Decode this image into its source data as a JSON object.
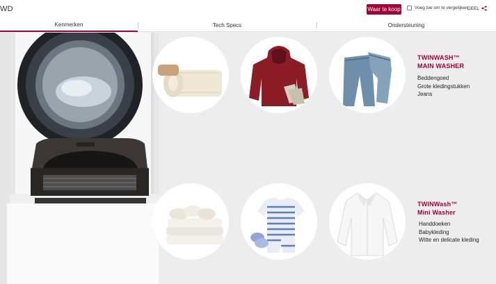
{
  "header": {
    "model_fragment": "WD",
    "buy_label": "Waar te koop",
    "compare_label": "Voeg toe om te vergelijken",
    "share_label": "DEEL"
  },
  "tabs": [
    {
      "label": "Kenmerken",
      "active": true
    },
    {
      "label": "Tech Specs",
      "active": false
    },
    {
      "label": "Ondersteuning",
      "active": false
    }
  ],
  "features": [
    {
      "title_line1": "TWINWASH™",
      "title_line2": "MAIN WASHER",
      "items": [
        "Beddengoed",
        "Grote kledingstukken",
        "Jeans"
      ]
    },
    {
      "title_line1": "TWINWash™",
      "title_line2": "Mini Washer",
      "items": [
        "Handdoeken",
        "Babykleding",
        "Witte en delicate kleding"
      ]
    }
  ],
  "colors": {
    "accent": "#a50034"
  }
}
